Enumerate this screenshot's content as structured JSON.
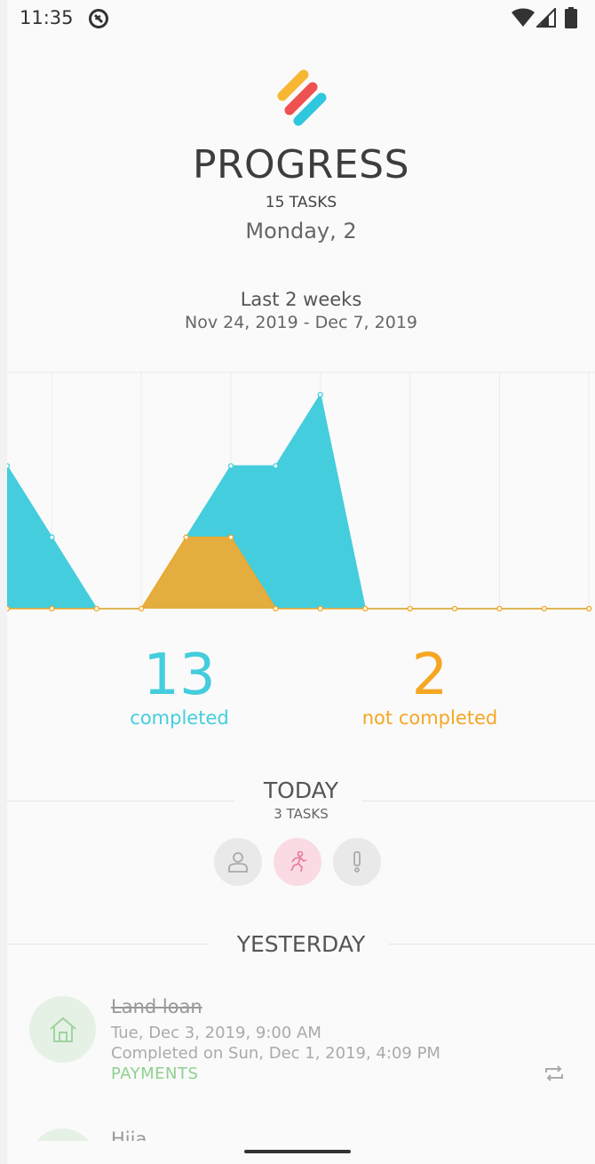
{
  "status_bar": {
    "time": "11:35"
  },
  "header": {
    "title": "PROGRESS",
    "subtitle": "15 TASKS",
    "date": "Monday, 2"
  },
  "range": {
    "title": "Last 2 weeks",
    "dates": "Nov 24, 2019 - Dec 7, 2019"
  },
  "colors": {
    "completed": "#44cddd",
    "not_completed": "#f5a623",
    "not_completed_fill": "#e3ad40",
    "payments": "#8fd08f"
  },
  "chart_data": {
    "type": "area",
    "x": [
      0,
      1,
      2,
      3,
      4,
      5,
      6,
      7,
      8,
      9,
      10,
      11,
      12,
      13
    ],
    "series": [
      {
        "values": [
          2,
          1,
          0,
          0,
          1,
          2,
          2,
          3,
          0,
          0,
          0,
          0,
          0,
          0
        ]
      },
      {
        "values": [
          0,
          0,
          0,
          0,
          1,
          1,
          0,
          0,
          0,
          0,
          0,
          0,
          0,
          0
        ]
      }
    ],
    "ylim": [
      0,
      3.3
    ],
    "grid": true,
    "title": "",
    "xlabel": "",
    "ylabel": ""
  },
  "stats": {
    "completed_count": "13",
    "completed_label": "completed",
    "not_completed_count": "2",
    "not_completed_label": "not completed"
  },
  "today": {
    "title": "TODAY",
    "subtitle": "3 TASKS",
    "categories": [
      "person-icon",
      "runner-icon",
      "exclamation-icon"
    ]
  },
  "yesterday": {
    "title": "YESTERDAY",
    "tasks": [
      {
        "title": "Land loan",
        "due": "Tue, Dec 3, 2019, 9:00 AM",
        "completed_on": "Completed on Sun, Dec 1, 2019, 4:09 PM",
        "category": "PAYMENTS",
        "icon": "home-icon"
      },
      {
        "title": "Hija"
      }
    ]
  }
}
